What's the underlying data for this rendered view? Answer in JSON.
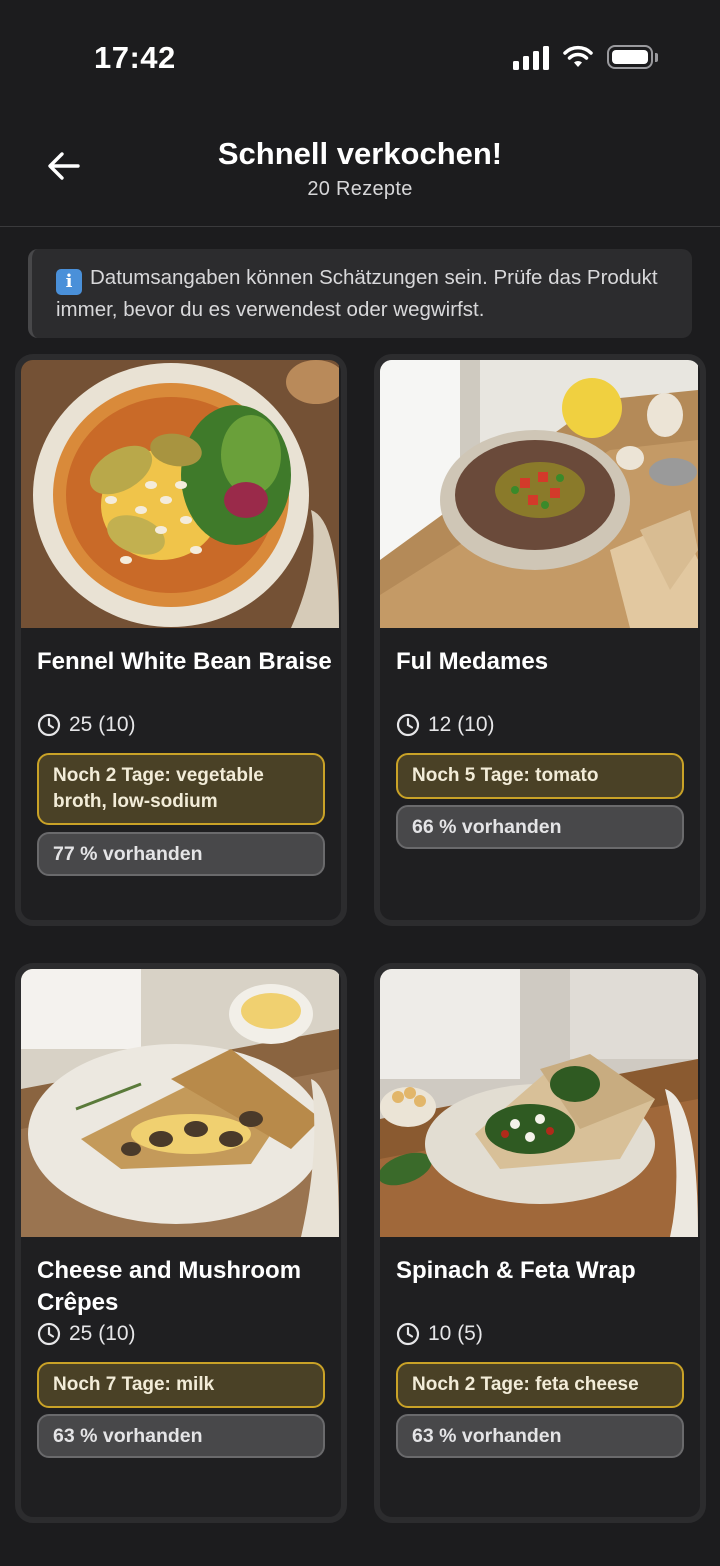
{
  "status_bar": {
    "time": "17:42"
  },
  "header": {
    "title": "Schnell verkochen!",
    "subtitle": "20 Rezepte"
  },
  "info_banner": {
    "text": "Datumsangaben können Schätzungen sein. Prüfe das Produkt immer, bevor du es verwendest oder wegwirfst."
  },
  "recipes": [
    {
      "title": "Fennel White Bean Braise",
      "time": "25 (10)",
      "expiry": "Noch 2 Tage: vegetable broth, low-sodium",
      "availability": "77 % vorhanden"
    },
    {
      "title": "Ful Medames",
      "time": "12 (10)",
      "expiry": "Noch 5 Tage: tomato",
      "availability": "66 % vorhanden"
    },
    {
      "title": "Cheese and Mushroom Crêpes",
      "time": "25 (10)",
      "expiry": "Noch 7 Tage: milk",
      "availability": "63 % vorhanden"
    },
    {
      "title": "Spinach & Feta Wrap",
      "time": "10 (5)",
      "expiry": "Noch 2 Tage: feta cheese",
      "availability": "63 % vorhanden"
    }
  ],
  "colors": {
    "background": "#1c1c1e",
    "card": "#1f1f21",
    "expiry_border": "#c9a227",
    "expiry_fill": "#4a4126",
    "info_icon": "#4a90d9"
  }
}
